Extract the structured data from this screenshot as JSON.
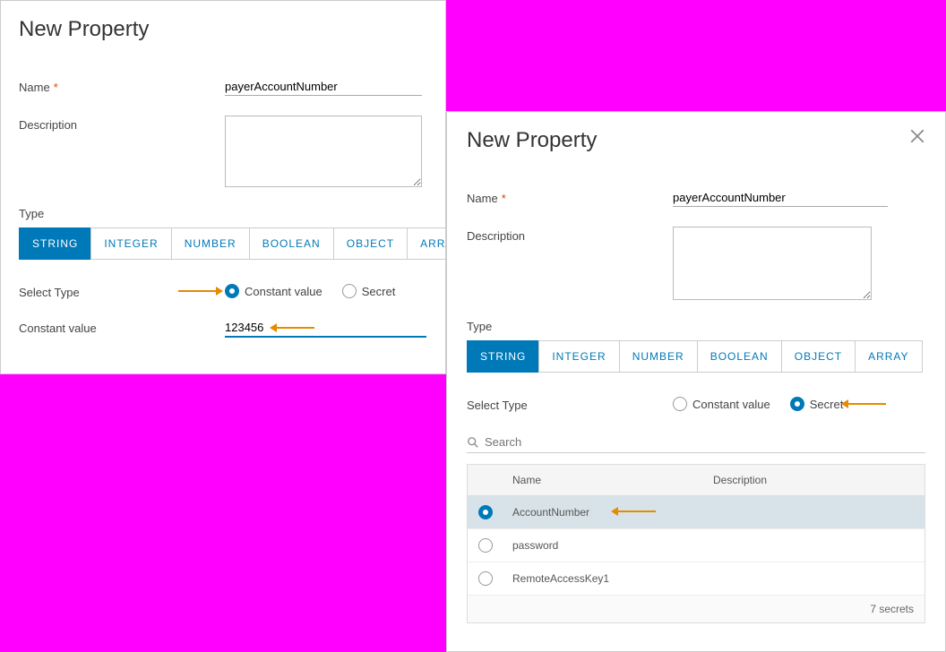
{
  "left": {
    "title": "New Property",
    "name_label": "Name",
    "name_value": "payerAccountNumber",
    "description_label": "Description",
    "description_value": "",
    "type_label": "Type",
    "type_options": [
      "STRING",
      "INTEGER",
      "NUMBER",
      "BOOLEAN",
      "OBJECT",
      "ARRA"
    ],
    "type_selected": "STRING",
    "select_type_label": "Select Type",
    "radio_constant": "Constant value",
    "radio_secret": "Secret",
    "radio_selected": "constant",
    "constant_value_label": "Constant value",
    "constant_value_value": "123456"
  },
  "right": {
    "title": "New Property",
    "name_label": "Name",
    "name_value": "payerAccountNumber",
    "description_label": "Description",
    "description_value": "",
    "type_label": "Type",
    "type_options": [
      "STRING",
      "INTEGER",
      "NUMBER",
      "BOOLEAN",
      "OBJECT",
      "ARRAY"
    ],
    "type_selected": "STRING",
    "select_type_label": "Select Type",
    "radio_constant": "Constant value",
    "radio_secret": "Secret",
    "radio_selected": "secret",
    "search_placeholder": "Search",
    "table_header_name": "Name",
    "table_header_description": "Description",
    "secrets": [
      {
        "name": "AccountNumber",
        "selected": true
      },
      {
        "name": "password",
        "selected": false
      },
      {
        "name": "RemoteAccessKey1",
        "selected": false
      }
    ],
    "footer_count": "7 secrets"
  },
  "colors": {
    "accent": "#0079b8",
    "annotation": "#e68a00"
  }
}
